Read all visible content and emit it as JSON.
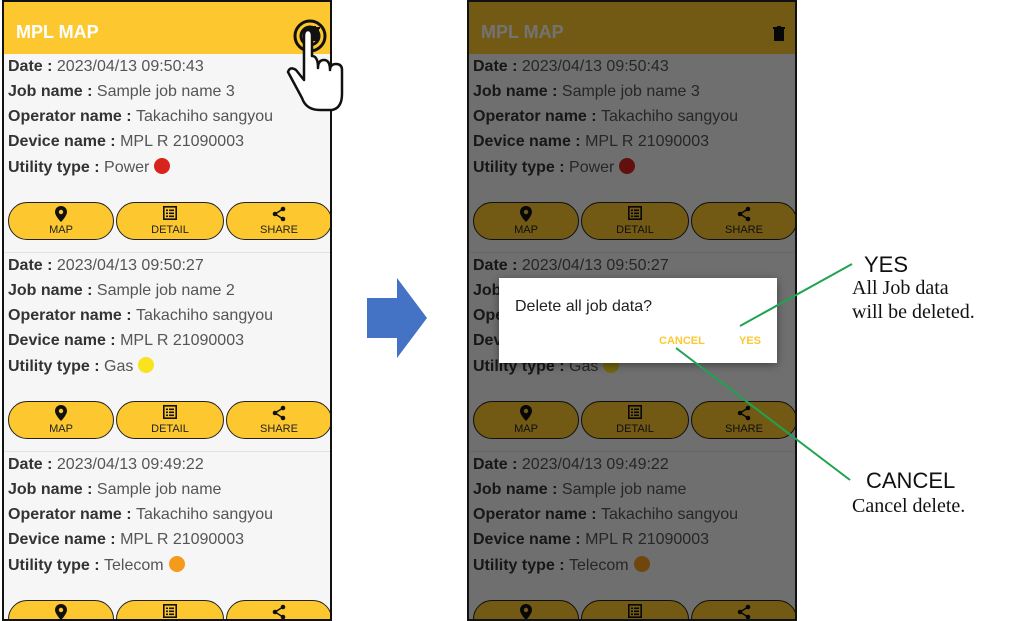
{
  "app": {
    "title": "MPL MAP"
  },
  "labels": {
    "date": "Date : ",
    "job": "Job name : ",
    "operator": "Operator name : ",
    "device": "Device name : ",
    "utility": "Utility type : "
  },
  "jobs": [
    {
      "date": "2023/04/13 09:50:43",
      "job_name": "Sample job name 3",
      "operator": "Takachiho sangyou",
      "device": "MPL R 21090003",
      "utility": "Power",
      "utility_color": "#d9241d"
    },
    {
      "date": "2023/04/13 09:50:27",
      "job_name": "Sample job name 2",
      "operator": "Takachiho sangyou",
      "device": "MPL R 21090003",
      "utility": "Gas",
      "utility_color": "#f9e31f"
    },
    {
      "date": "2023/04/13 09:49:22",
      "job_name": "Sample job name",
      "operator": "Takachiho sangyou",
      "device": "MPL R 21090003",
      "utility": "Telecom",
      "utility_color": "#f59b1b"
    }
  ],
  "buttons": {
    "map": "MAP",
    "detail": "DETAIL",
    "share": "SHARE"
  },
  "icons": {
    "delete": "trash-icon",
    "map": "location-pin-icon",
    "detail": "list-icon",
    "share": "share-icon",
    "tap": "hand-tap-icon",
    "arrow": "right-arrow-icon"
  },
  "dialog": {
    "message": "Delete all job data?",
    "cancel": "CANCEL",
    "yes": "YES"
  },
  "annotations": {
    "yes_title": "YES",
    "yes_desc_1": "All Job data",
    "yes_desc_2": "will be deleted.",
    "cancel_title": "CANCEL",
    "cancel_desc": "Cancel delete."
  },
  "colors": {
    "accent": "#fdc82f",
    "arrow": "#4472c4",
    "callout_line": "#1fa350"
  }
}
